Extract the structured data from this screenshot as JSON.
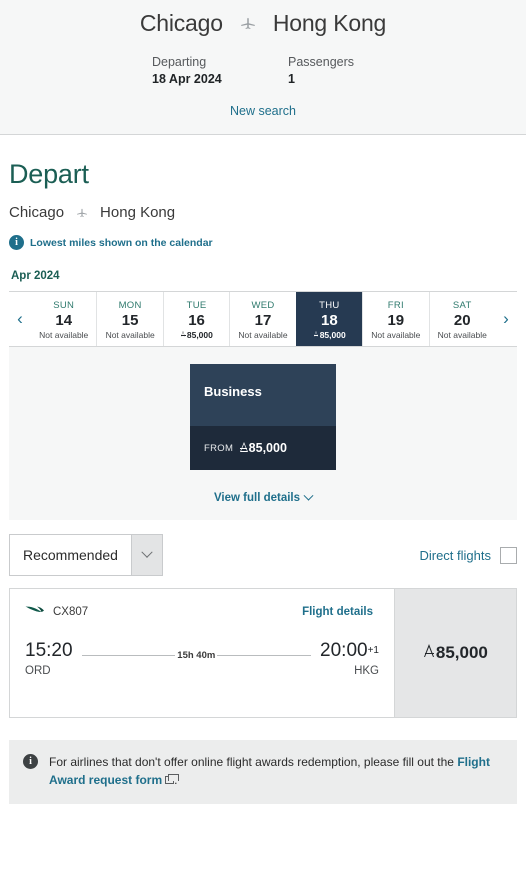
{
  "header": {
    "origin": "Chicago",
    "destination": "Hong Kong",
    "plane_icon": "plane-icon",
    "departing_label": "Departing",
    "departing_value": "18 Apr 2024",
    "passengers_label": "Passengers",
    "passengers_value": "1",
    "new_search_label": "New search"
  },
  "depart": {
    "title": "Depart",
    "origin": "Chicago",
    "destination": "Hong Kong",
    "lowest_miles_note": "Lowest miles shown on the calendar",
    "info_glyph": "i"
  },
  "calendar": {
    "month_label": "Apr 2024",
    "prev_glyph": "‹",
    "next_glyph": "›",
    "unavailable_label": "Not available",
    "days": [
      {
        "dow": "SUN",
        "num": "14",
        "status": "Not available",
        "price": null,
        "selected": false
      },
      {
        "dow": "MON",
        "num": "15",
        "status": "Not available",
        "price": null,
        "selected": false
      },
      {
        "dow": "TUE",
        "num": "16",
        "status": null,
        "price": "85,000",
        "selected": false
      },
      {
        "dow": "WED",
        "num": "17",
        "status": "Not available",
        "price": null,
        "selected": false
      },
      {
        "dow": "THU",
        "num": "18",
        "status": null,
        "price": "85,000",
        "selected": true
      },
      {
        "dow": "FRI",
        "num": "19",
        "status": "Not available",
        "price": null,
        "selected": false
      },
      {
        "dow": "SAT",
        "num": "20",
        "status": "Not available",
        "price": null,
        "selected": false
      }
    ]
  },
  "cabin": {
    "name": "Business",
    "from_label": "FROM",
    "price": "85,000",
    "view_full_details": "View full details",
    "chevron_icon": "chevron-down-icon"
  },
  "filters": {
    "sort_value": "Recommended",
    "sort_chevron_icon": "chevron-down-icon",
    "direct_flights_label": "Direct flights",
    "direct_flights_checked": false
  },
  "flight": {
    "airline_logo": "cathay-brushwing-icon",
    "flight_number": "CX807",
    "details_link": "Flight details",
    "depart_time": "15:20",
    "depart_code": "ORD",
    "duration": "15h 40m",
    "arrive_time": "20:00",
    "arrive_day_offset": "+1",
    "arrive_code": "HKG",
    "price": "85,000"
  },
  "notice": {
    "info_glyph": "i",
    "text_before": "For airlines that don't offer online flight awards redemption, please fill out the",
    "link_label": "Flight Award request form",
    "external_icon": "external-link-icon",
    "text_after": "."
  },
  "colors": {
    "accent_teal": "#1f6f8b",
    "depart_green": "#1b5e54",
    "selected_navy": "#263a52",
    "card_navy_top": "#2e4258",
    "card_navy_bottom": "#1e2a3a",
    "panel_gray": "#f6f7f7",
    "price_cell_gray": "#e5e6e7"
  }
}
